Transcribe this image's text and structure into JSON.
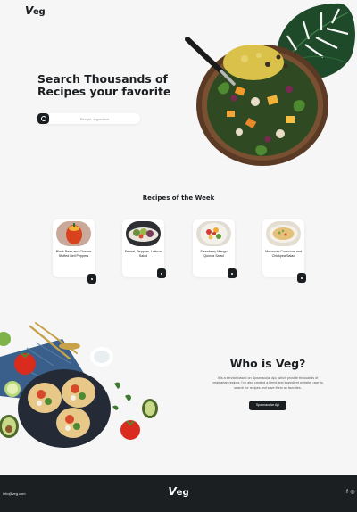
{
  "header": {
    "logo_initial": "V",
    "logo_rest": "eg",
    "menu_icon": "menu-icon"
  },
  "hero": {
    "title": "Search Thousands of Recipes your favorite",
    "search": {
      "placeholder": "Recipe, Ingredient",
      "button_icon": "search-icon"
    },
    "image": "salad-bowl"
  },
  "recipes_week": {
    "title": "Recipes of the Week",
    "cards": [
      {
        "name": "Black Bean and Cheese Stuffed Bell Peppers",
        "button_icon": "arrow-icon"
      },
      {
        "name": "Fennel, Peppers, Lettuce Salad",
        "button_icon": "arrow-icon"
      },
      {
        "name": "Strawberry Mango Quinoa Salad",
        "button_icon": "arrow-icon"
      },
      {
        "name": "Moroccan Couscous and Chickpea Salad",
        "button_icon": "arrow-icon"
      }
    ]
  },
  "about": {
    "title": "Who is Veg?",
    "description": "It is a service based on Spoonacular Api, which provide thousands of vegetarian recipes. I've also created a blend and Ingredient website, user to search for recipes and save them as favorites.",
    "button": "Spoonacular Api"
  },
  "footer": {
    "email": "info@veg.com",
    "logo_initial": "V",
    "logo_rest": "eg",
    "social": [
      {
        "icon": "facebook-icon",
        "glyph": "f"
      },
      {
        "icon": "instagram-icon",
        "glyph": "◎"
      }
    ]
  },
  "colors": {
    "background": "#f6f6f6",
    "dark": "#1b1e21",
    "card": "#ffffff",
    "footer": "#1c1f22"
  }
}
